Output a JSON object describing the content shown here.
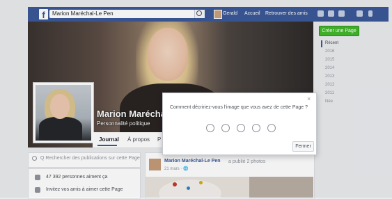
{
  "topbar": {
    "logo": "f",
    "search_value": "Marion Maréchal-Le Pen",
    "nav": {
      "user": "Gerald",
      "home": "Accueil",
      "find_friends": "Retrouver des amis"
    },
    "icons": [
      "friend-requests-icon",
      "messages-icon",
      "notifications-icon",
      "privacy-icon",
      "account-menu-icon"
    ]
  },
  "profile": {
    "name": "Marion Maréchal",
    "category": "Personnalité politique"
  },
  "tabs": {
    "journal": "Journal",
    "about": "À propos",
    "more": "P"
  },
  "left": {
    "search_placeholder": "Q  Rechercher des publications sur cette Page",
    "rows": [
      {
        "text": "47 392 personnes aiment ça",
        "icon": "like-icon"
      },
      {
        "text": "Invitez vos amis à aimer cette Page",
        "icon": "invite-icon"
      }
    ]
  },
  "post": {
    "author": "Marion Maréchal-Le Pen",
    "meta": "a publié 2 photos",
    "date": "21 mars · 🌐"
  },
  "right": {
    "create_page": "Créer une Page",
    "years": [
      "Récent",
      "2016",
      "2015",
      "2014",
      "2013",
      "2012",
      "2011",
      "Née"
    ]
  },
  "modal": {
    "close_symbol": "×",
    "question": "Comment décririez-vous l’image que vous avez de cette Page ?",
    "close_button": "Fermer",
    "faces": [
      "very-dissatisfied-icon",
      "dissatisfied-icon",
      "neutral-icon",
      "satisfied-icon",
      "very-satisfied-icon"
    ]
  },
  "colors": {
    "facebook_blue": "#3b5998",
    "green": "#42b72a",
    "background": "#e9ebee"
  }
}
